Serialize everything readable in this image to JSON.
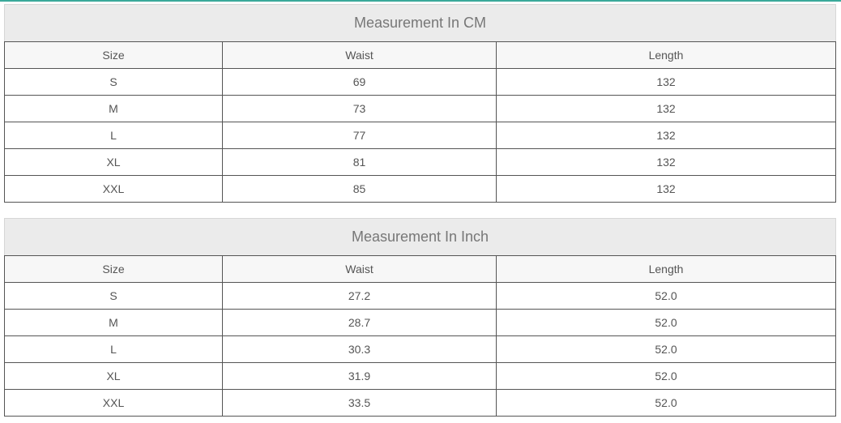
{
  "accent_color": "#3aa99a",
  "tables": [
    {
      "title": "Measurement In CM",
      "headers": [
        "Size",
        "Waist",
        "Length"
      ],
      "rows": [
        [
          "S",
          "69",
          "132"
        ],
        [
          "M",
          "73",
          "132"
        ],
        [
          "L",
          "77",
          "132"
        ],
        [
          "XL",
          "81",
          "132"
        ],
        [
          "XXL",
          "85",
          "132"
        ]
      ]
    },
    {
      "title": "Measurement In Inch",
      "headers": [
        "Size",
        "Waist",
        "Length"
      ],
      "rows": [
        [
          "S",
          "27.2",
          "52.0"
        ],
        [
          "M",
          "28.7",
          "52.0"
        ],
        [
          "L",
          "30.3",
          "52.0"
        ],
        [
          "XL",
          "31.9",
          "52.0"
        ],
        [
          "XXL",
          "33.5",
          "52.0"
        ]
      ]
    }
  ]
}
